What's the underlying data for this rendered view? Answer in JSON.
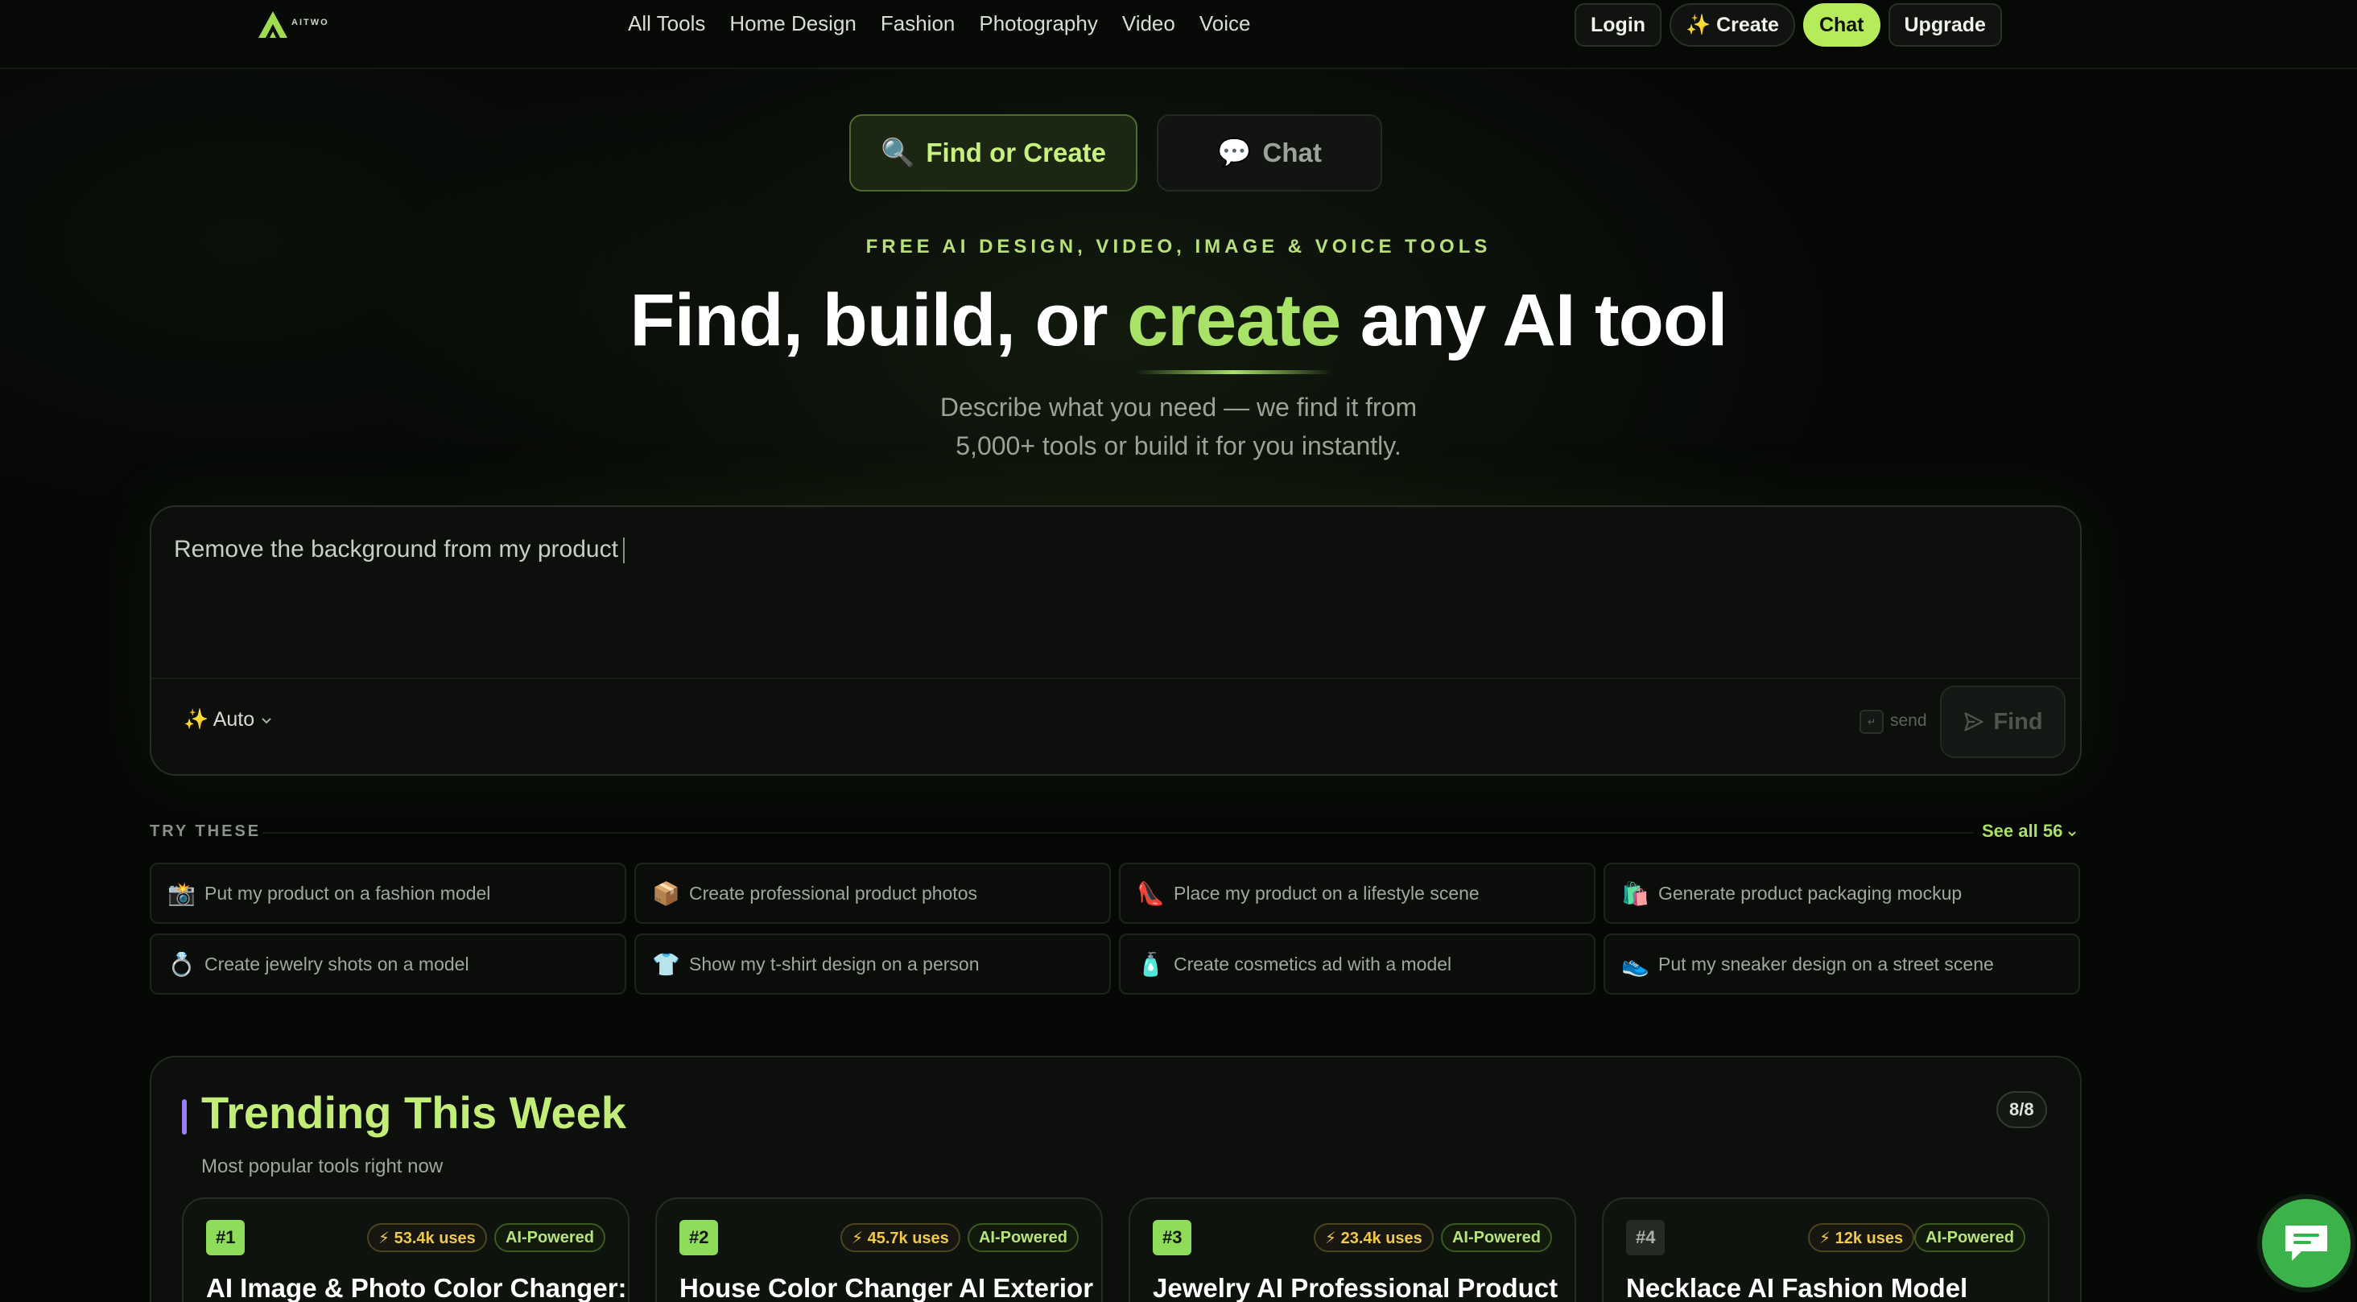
{
  "brand": {
    "logo_text": "AITWO"
  },
  "nav": {
    "links": [
      "All Tools",
      "Home Design",
      "Fashion",
      "Photography",
      "Video",
      "Voice"
    ],
    "login": "Login",
    "create": "✨ Create",
    "chat": "Chat",
    "upgrade": "Upgrade"
  },
  "modes": {
    "find": {
      "icon": "🔍",
      "label": "Find or Create"
    },
    "chat": {
      "icon": "💬",
      "label": "Chat"
    }
  },
  "hero": {
    "eyebrow": "FREE AI DESIGN, VIDEO, IMAGE & VOICE TOOLS",
    "headline_pre": "Find, build, or ",
    "headline_accent": "create",
    "headline_post": " any AI tool",
    "sub_line1": "Describe what you need — we find it from",
    "sub_line2": "5,000+ tools or build it for you instantly."
  },
  "input": {
    "text": "Remove the background from my product",
    "mode": "✨ Auto",
    "kbd_hint": "↵",
    "send_hint": "send",
    "find_label": "Find"
  },
  "suggestions": {
    "label": "TRY THESE",
    "see_all": "See all 56",
    "items": [
      {
        "icon": "📸",
        "text": "Put my product on a fashion model"
      },
      {
        "icon": "📦",
        "text": "Create professional product photos"
      },
      {
        "icon": "👠",
        "text": "Place my product on a lifestyle scene"
      },
      {
        "icon": "🛍️",
        "text": "Generate product packaging mockup"
      },
      {
        "icon": "💍",
        "text": "Create jewelry shots on a model"
      },
      {
        "icon": "👕",
        "text": "Show my t-shirt design on a person"
      },
      {
        "icon": "🧴",
        "text": "Create cosmetics ad with a model"
      },
      {
        "icon": "👟",
        "text": "Put my sneaker design on a street scene"
      }
    ]
  },
  "trending": {
    "title": "Trending This Week",
    "subtitle": "Most popular tools right now",
    "count": "8/8",
    "cards": [
      {
        "rank": "#1",
        "uses": "⚡ 53.4k uses",
        "badge": "AI-Powered",
        "name": "AI Image & Photo Color Changer:"
      },
      {
        "rank": "#2",
        "uses": "⚡ 45.7k uses",
        "badge": "AI-Powered",
        "name": "House Color Changer AI Exterior"
      },
      {
        "rank": "#3",
        "uses": "⚡ 23.4k uses",
        "badge": "AI-Powered",
        "name": "Jewelry AI Professional Product"
      },
      {
        "rank": "#4",
        "uses": "⚡ 12k uses",
        "badge": "AI-Powered",
        "name": "Necklace AI Fashion Model"
      }
    ]
  },
  "colors": {
    "accent": "#a8e267",
    "chat_button": "#b6ec5c",
    "float_chat": "#3bb34a",
    "background": "#060806"
  }
}
